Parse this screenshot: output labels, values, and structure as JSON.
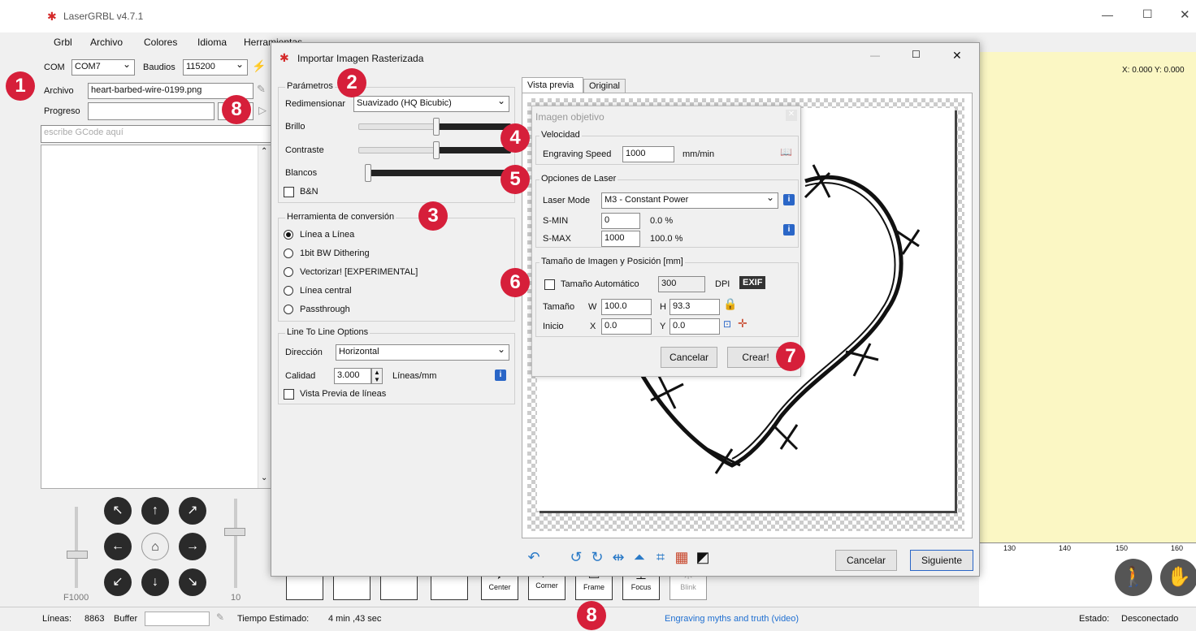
{
  "app": {
    "title": "LaserGRBL v4.7.1",
    "window_controls": [
      "—",
      "☐",
      "✕"
    ]
  },
  "menu": [
    "Grbl",
    "Archivo",
    "Colores",
    "Idioma",
    "Herramientas",
    "?"
  ],
  "left": {
    "com_label": "COM",
    "com_value": "COM7",
    "baud_label": "Baudios",
    "baud_value": "115200",
    "file_label": "Archivo",
    "file_value": "heart-barbed-wire-0199.png",
    "progress_label": "Progreso",
    "gcode_placeholder": "escribe GCode aquí",
    "speed_left": "F1000",
    "speed_right": "10"
  },
  "canvas": {
    "coords": "X: 0.000 Y: 0.000",
    "ruler": [
      "130",
      "140",
      "150",
      "160"
    ]
  },
  "toolbar": [
    "Center",
    "Corner",
    "Frame",
    "Focus",
    "Blink"
  ],
  "status": {
    "lines_label": "Líneas:",
    "lines_value": "8863",
    "buffer_label": "Buffer",
    "time_label": "Tiempo Estimado:",
    "time_value": "4 min ,43 sec",
    "link": "Engraving myths and truth (video)",
    "state_label": "Estado:",
    "state_value": "Desconectado",
    "link_color": "#1f6fd1"
  },
  "dialog": {
    "title": "Importar Imagen Rasterizada",
    "params": {
      "title": "Parámetros",
      "resize_label": "Redimensionar",
      "resize_value": "Suavizado (HQ Bicubic)",
      "brightness": "Brillo",
      "contrast": "Contraste",
      "whites": "Blancos",
      "bw": "B&N"
    },
    "conversion": {
      "title": "Herramienta de conversión",
      "options": [
        "Línea a Línea",
        "1bit BW Dithering",
        "Vectorizar! [EXPERIMENTAL]",
        "Línea central",
        "Passthrough"
      ]
    },
    "l2l": {
      "title": "Line To Line Options",
      "direction_label": "Dirección",
      "direction_value": "Horizontal",
      "quality_label": "Calidad",
      "quality_value": "3.000",
      "quality_unit": "Líneas/mm",
      "preview_lines": "Vista Previa de líneas"
    },
    "tabs": [
      "Vista previa",
      "Original"
    ],
    "cancel": "Cancelar",
    "next": "Siguiente"
  },
  "target": {
    "title": "Imagen objetivo",
    "speed_title": "Velocidad",
    "speed_label": "Engraving Speed",
    "speed_value": "1000",
    "speed_unit": "mm/min",
    "laser_title": "Opciones de Laser",
    "laser_mode_label": "Laser Mode",
    "laser_mode_value": "M3 - Constant Power",
    "smin_label": "S-MIN",
    "smin_value": "0",
    "smin_pct": "0.0 %",
    "smax_label": "S-MAX",
    "smax_value": "1000",
    "smax_pct": "100.0 %",
    "size_title": "Tamaño de Imagen y Posición [mm]",
    "auto_size": "Tamaño Automático",
    "dpi_value": "300",
    "dpi_label": "DPI",
    "exif": "EXIF",
    "size_label": "Tamaño",
    "w_label": "W",
    "w_value": "100.0",
    "h_label": "H",
    "h_value": "93.3",
    "start_label": "Inicio",
    "x_label": "X",
    "x_value": "0.0",
    "y_label": "Y",
    "y_value": "0.0",
    "cancel": "Cancelar",
    "create": "Crear!"
  },
  "badges": [
    "1",
    "2",
    "3",
    "4",
    "5",
    "6",
    "7",
    "8",
    "8"
  ],
  "colors": {
    "badge": "#d61f3a",
    "canvas": "#fbf7c4",
    "info": "#2a66c7"
  }
}
